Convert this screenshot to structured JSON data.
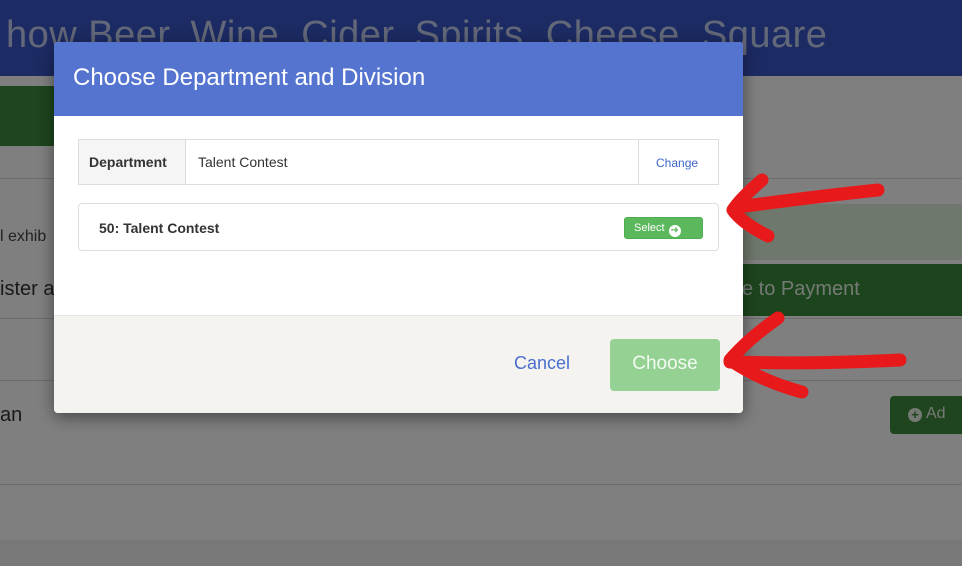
{
  "background": {
    "header_title": "how Beer, Wine, Cider, Spirits, Cheese, Square",
    "exhibit_text": "l exhib",
    "register_text": "ister a",
    "payment_button": "e to Payment",
    "row_text": "an",
    "add_button": "Ad"
  },
  "modal": {
    "title": "Choose Department and Division",
    "department": {
      "label": "Department",
      "value": "Talent Contest",
      "change_link": "Change"
    },
    "division": {
      "label": "50: Talent Contest",
      "select_button": "Select"
    },
    "footer": {
      "cancel_label": "Cancel",
      "choose_label": "Choose"
    }
  },
  "colors": {
    "modal_header": "#5574cf",
    "select_green": "#5cb85c",
    "choose_disabled_green": "#8fd08f",
    "annotation_red": "#e8191b"
  },
  "icons": {
    "select_icon": "circle-arrow-right-icon",
    "add_icon": "circle-plus-icon",
    "annotations": "red-arrow-icon"
  }
}
